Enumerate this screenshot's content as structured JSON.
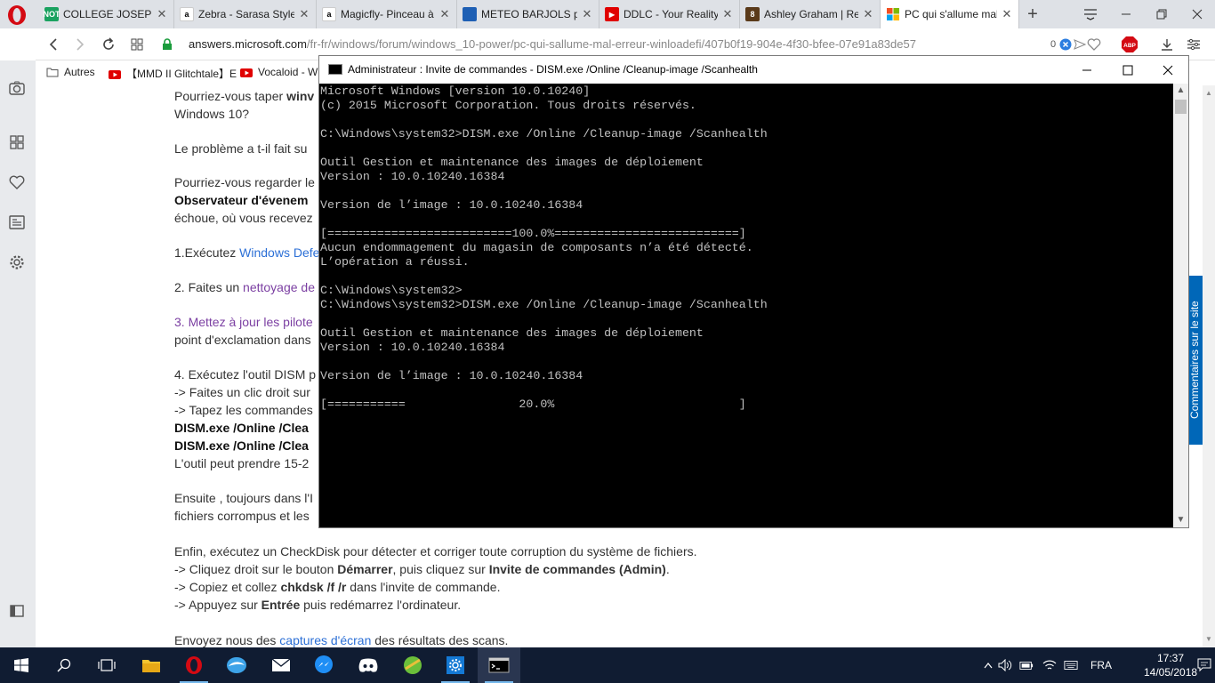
{
  "browser": {
    "tabs": [
      {
        "title": "COLLEGE JOSEPH D",
        "icon": "college-favicon",
        "color": "#1aa260",
        "glyph": "NOT"
      },
      {
        "title": "Zebra - Sarasa Style",
        "icon": "amazon-favicon",
        "color": "#ffffff",
        "glyph": "a"
      },
      {
        "title": "Magicfly- Pinceau à",
        "icon": "amazon-favicon",
        "color": "#ffffff",
        "glyph": "a"
      },
      {
        "title": "METEO BARJOLS p",
        "icon": "meteo-favicon",
        "color": "#1e5fb4",
        "glyph": ""
      },
      {
        "title": "DDLC - Your Reality",
        "icon": "youtube-favicon",
        "color": "#e00000",
        "glyph": "▶"
      },
      {
        "title": "Ashley Graham | Re",
        "icon": "site-favicon",
        "color": "#5a3a1a",
        "glyph": "8"
      },
      {
        "title": "PC qui s'allume mal",
        "icon": "microsoft-favicon",
        "color": "#f25022",
        "glyph": ""
      }
    ],
    "url_host": "answers.microsoft.com",
    "url_path": "/fr-fr/windows/forum/windows_10-power/pc-qui-sallume-mal-erreur-winloadefi/407b0f19-904e-4f30-bfee-07e91a83de57",
    "adblock_count": "0",
    "bookmarks": [
      {
        "label": "Autres",
        "icon": "folder-icon"
      },
      {
        "label": "【MMD II Glitchtale】E",
        "icon": "youtube-icon"
      },
      {
        "label": "Vocaloid - W",
        "icon": "youtube-icon"
      }
    ]
  },
  "page": {
    "lines": [
      {
        "pre": "Pourriez-vous taper ",
        "b": "winv",
        "post": ""
      },
      {
        "pre": "Windows 10?",
        "b": "",
        "post": ""
      },
      {
        "pre": "Le problème a t-il fait su",
        "b": "",
        "post": ""
      },
      {
        "pre": "Pourriez-vous regarder le",
        "b": "",
        "post": ""
      },
      {
        "pre": "",
        "b": "Observateur d'évenem",
        "post": ""
      },
      {
        "pre": "échoue, où vous recevez",
        "b": "",
        "post": ""
      },
      {
        "pre": "1.Exécutez ",
        "link": "Windows Defe",
        "post": ""
      },
      {
        "pre": "2. Faites un ",
        "link_purple": "nettoyage de",
        "post": ""
      },
      {
        "pre": "3. ",
        "link_purple": "Mettez à jour les pilote",
        "post": ""
      },
      {
        "pre": "point d'exclamation dans",
        "b": "",
        "post": ""
      },
      {
        "pre": "4. Exécutez l'outil DISM p",
        "b": "",
        "post": ""
      },
      {
        "pre": "-> Faites un clic droit sur",
        "b": "",
        "post": ""
      },
      {
        "pre": "-> Tapez les commandes",
        "b": "",
        "post": ""
      },
      {
        "pre": "",
        "b": "DISM.exe /Online /Clea",
        "post": ""
      },
      {
        "pre": "",
        "b": "DISM.exe /Online /Clea",
        "post": ""
      },
      {
        "pre": "L'outil peut prendre 15-2",
        "b": "",
        "post": ""
      },
      {
        "pre": "Ensuite , toujours dans l'I",
        "b": "",
        "post": ""
      },
      {
        "pre": "fichiers corrompus et les",
        "b": "",
        "post": ""
      }
    ],
    "checkdisk_intro": "Enfin, exécutez un CheckDisk pour détecter et corriger toute corruption du système de fichiers.",
    "step1_pre": "-> Cliquez droit sur le bouton ",
    "step1_b1": "Démarrer",
    "step1_mid": ", puis cliquez sur ",
    "step1_b2": "Invite de commandes (Admin)",
    "step1_post": ".",
    "step2_pre": "-> Copiez et collez ",
    "step2_b": "chkdsk /f /r",
    "step2_post": " dans l'invite de commande.",
    "step3_pre": "-> Appuyez sur ",
    "step3_b": "Entrée",
    "step3_post": " puis redémarrez l'ordinateur.",
    "final_pre": "Envoyez nous des ",
    "final_link": "captures d'écran",
    "final_post": " des résultats des scans.",
    "feedback_label": "Commentaires sur le site"
  },
  "cmd": {
    "title": "Administrateur : Invite de commandes - DISM.exe  /Online /Cleanup-image /Scanhealth",
    "output": "Microsoft Windows [version 10.0.10240]\n(c) 2015 Microsoft Corporation. Tous droits réservés.\n\nC:\\Windows\\system32>DISM.exe /Online /Cleanup-image /Scanhealth\n\nOutil Gestion et maintenance des images de déploiement\nVersion : 10.0.10240.16384\n\nVersion de l’image : 10.0.10240.16384\n\n[==========================100.0%==========================]\nAucun endommagement du magasin de composants n’a été détecté.\nL’opération a réussi.\n\nC:\\Windows\\system32>\nC:\\Windows\\system32>DISM.exe /Online /Cleanup-image /Scanhealth\n\nOutil Gestion et maintenance des images de déploiement\nVersion : 10.0.10240.16384\n\nVersion de l’image : 10.0.10240.16384\n\n[===========                20.0%                          ]",
    "progress_percent": 20.0
  },
  "taskbar": {
    "apps": [
      "start-icon",
      "search-icon",
      "task-view-icon",
      "file-explorer-icon",
      "opera-icon",
      "app-icon",
      "mail-icon",
      "messenger-icon",
      "discord-icon",
      "game-icon",
      "settings-icon",
      "cmd-icon"
    ],
    "language": "FRA",
    "time": "17:37",
    "date": "14/05/2018"
  },
  "colors": {
    "accent": "#0067b8",
    "link": "#2b6fd6",
    "visited_link": "#7b3fa2",
    "taskbar": "#101c32",
    "console_bg": "#000000",
    "console_fg": "#c0c0c0"
  }
}
